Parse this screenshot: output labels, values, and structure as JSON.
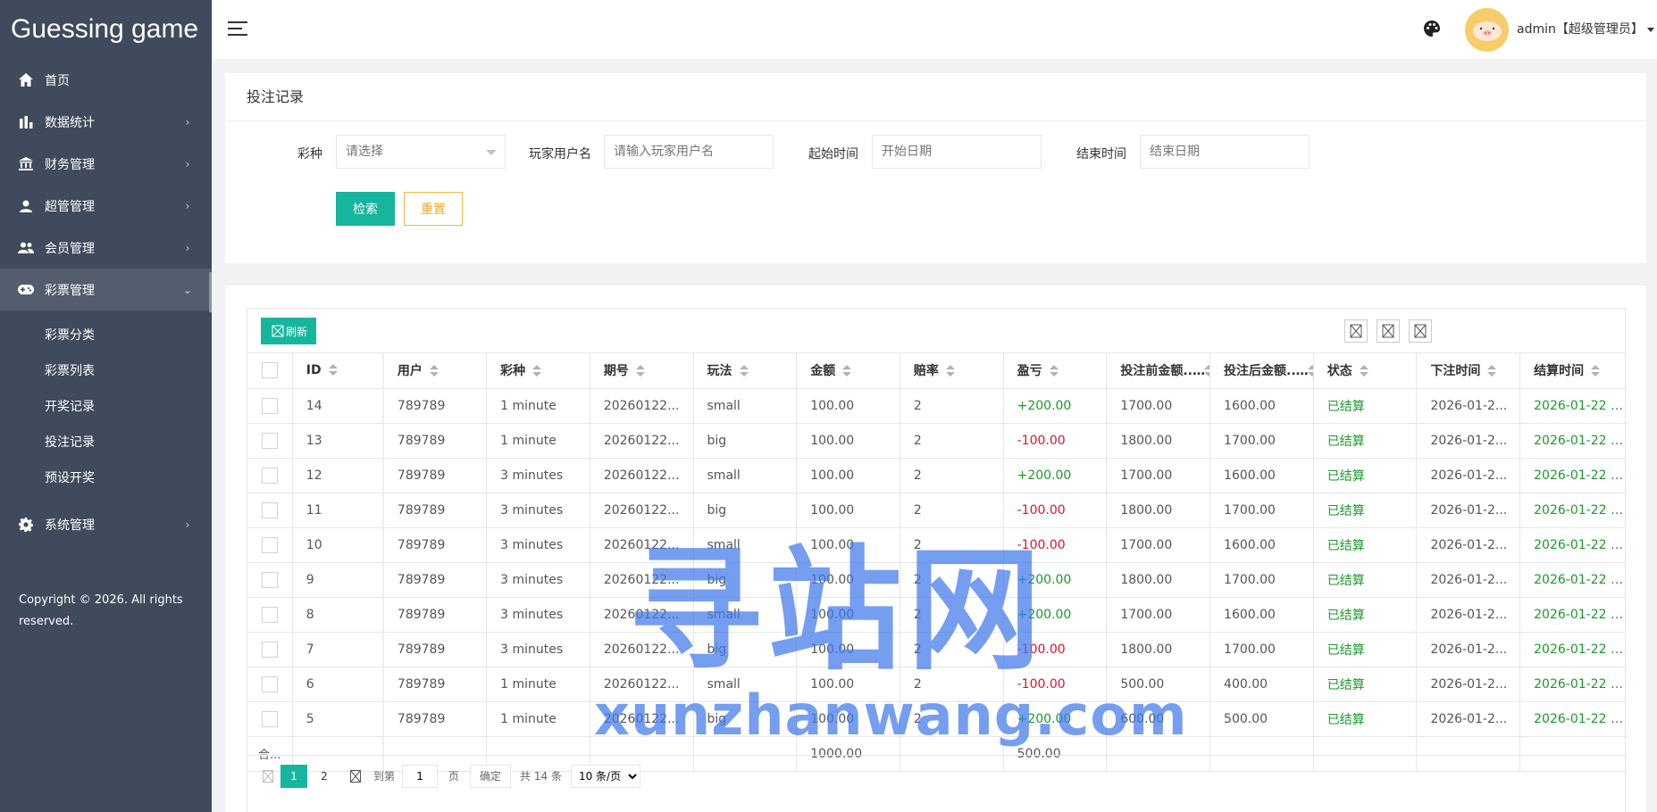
{
  "sidebar": {
    "logo": "Guessing game",
    "items": [
      {
        "label": "首页",
        "icon": "home-icon",
        "arrow": ""
      },
      {
        "label": "数据统计",
        "icon": "bar-chart-icon",
        "arrow": "›"
      },
      {
        "label": "财务管理",
        "icon": "bank-icon",
        "arrow": "›"
      },
      {
        "label": "超管管理",
        "icon": "user-icon",
        "arrow": "›"
      },
      {
        "label": "会员管理",
        "icon": "users-icon",
        "arrow": "›"
      },
      {
        "label": "彩票管理",
        "icon": "gamepad-icon",
        "arrow": "›"
      }
    ],
    "submenu": [
      "彩票分类",
      "彩票列表",
      "开奖记录",
      "投注记录",
      "预设开奖"
    ],
    "system": {
      "label": "系统管理",
      "icon": "gear-icon",
      "arrow": "›"
    },
    "copyright_line1": "Copyright © 2026. All rights",
    "copyright_line2": "reserved."
  },
  "header": {
    "user": "admin【超级管理员】"
  },
  "search": {
    "title": "投注记录",
    "lottery_label": "彩种",
    "lottery_placeholder": "请选择",
    "player_label": "玩家用户名",
    "player_placeholder": "请输入玩家用户名",
    "start_label": "起始时间",
    "start_placeholder": "开始日期",
    "end_label": "结束时间",
    "end_placeholder": "结束日期",
    "search_btn": "检索",
    "reset_btn": "重置"
  },
  "table": {
    "refresh_btn": "刷新",
    "columns": [
      "ID",
      "用户",
      "彩种",
      "期号",
      "玩法",
      "金额",
      "赔率",
      "盈亏",
      "投注前金额...",
      "投注后金额...",
      "状态",
      "下注时间",
      "结算时间"
    ],
    "rows": [
      {
        "id": "14",
        "user": "789789",
        "lottery": "1 minute",
        "period": "20260122...",
        "play": "small",
        "amount": "100.00",
        "odds": "2",
        "pl": "+200.00",
        "before": "1700.00",
        "after": "1600.00",
        "status": "已结算",
        "bet_time": "2026-01-2...",
        "settle_time": "2026-01-22 12:54"
      },
      {
        "id": "13",
        "user": "789789",
        "lottery": "1 minute",
        "period": "20260122...",
        "play": "big",
        "amount": "100.00",
        "odds": "2",
        "pl": "-100.00",
        "before": "1800.00",
        "after": "1700.00",
        "status": "已结算",
        "bet_time": "2026-01-2...",
        "settle_time": "2026-01-22 12:54"
      },
      {
        "id": "12",
        "user": "789789",
        "lottery": "3 minutes",
        "period": "20260122...",
        "play": "small",
        "amount": "100.00",
        "odds": "2",
        "pl": "+200.00",
        "before": "1700.00",
        "after": "1600.00",
        "status": "已结算",
        "bet_time": "2026-01-2...",
        "settle_time": "2026-01-22 12:51"
      },
      {
        "id": "11",
        "user": "789789",
        "lottery": "3 minutes",
        "period": "20260122...",
        "play": "big",
        "amount": "100.00",
        "odds": "2",
        "pl": "-100.00",
        "before": "1800.00",
        "after": "1700.00",
        "status": "已结算",
        "bet_time": "2026-01-2...",
        "settle_time": "2026-01-22 12:51"
      },
      {
        "id": "10",
        "user": "789789",
        "lottery": "3 minutes",
        "period": "20260122...",
        "play": "small",
        "amount": "100.00",
        "odds": "2",
        "pl": "-100.00",
        "before": "1700.00",
        "after": "1600.00",
        "status": "已结算",
        "bet_time": "2026-01-2...",
        "settle_time": "2026-01-22 12:42"
      },
      {
        "id": "9",
        "user": "789789",
        "lottery": "3 minutes",
        "period": "20260122...",
        "play": "big",
        "amount": "100.00",
        "odds": "2",
        "pl": "+200.00",
        "before": "1800.00",
        "after": "1700.00",
        "status": "已结算",
        "bet_time": "2026-01-2...",
        "settle_time": "2026-01-22 12:42"
      },
      {
        "id": "8",
        "user": "789789",
        "lottery": "3 minutes",
        "period": "20260122...",
        "play": "small",
        "amount": "100.00",
        "odds": "2",
        "pl": "+200.00",
        "before": "1700.00",
        "after": "1600.00",
        "status": "已结算",
        "bet_time": "2026-01-2...",
        "settle_time": "2026-01-22 12:30"
      },
      {
        "id": "7",
        "user": "789789",
        "lottery": "3 minutes",
        "period": "20260122...",
        "play": "big",
        "amount": "100.00",
        "odds": "2",
        "pl": "-100.00",
        "before": "1800.00",
        "after": "1700.00",
        "status": "已结算",
        "bet_time": "2026-01-2...",
        "settle_time": "2026-01-22 12:30"
      },
      {
        "id": "6",
        "user": "789789",
        "lottery": "1 minute",
        "period": "20260122...",
        "play": "small",
        "amount": "100.00",
        "odds": "2",
        "pl": "-100.00",
        "before": "500.00",
        "after": "400.00",
        "status": "已结算",
        "bet_time": "2026-01-2...",
        "settle_time": "2026-01-22 11:09"
      },
      {
        "id": "5",
        "user": "789789",
        "lottery": "1 minute",
        "period": "20260122...",
        "play": "big",
        "amount": "100.00",
        "odds": "2",
        "pl": "+200.00",
        "before": "600.00",
        "after": "500.00",
        "status": "已结算",
        "bet_time": "2026-01-2...",
        "settle_time": "2026-01-22 11:09"
      }
    ],
    "total_label": "合...",
    "total_amount": "1000.00",
    "total_pl": "500.00"
  },
  "pager": {
    "pages": [
      "1",
      "2"
    ],
    "current": "1",
    "goto_label": "到第",
    "goto_value": "1",
    "page_unit": "页",
    "confirm": "确定",
    "total": "共 14 条",
    "page_size": "10 条/页"
  },
  "watermark": {
    "cn": "寻站网",
    "en": "xunzhanwang.com"
  },
  "colors": {
    "sidebar_bg": "#3f4a5c",
    "accent": "#16b59e",
    "profit": "#1a9a2a",
    "loss": "#e0132d",
    "reset": "#f0a92b"
  }
}
